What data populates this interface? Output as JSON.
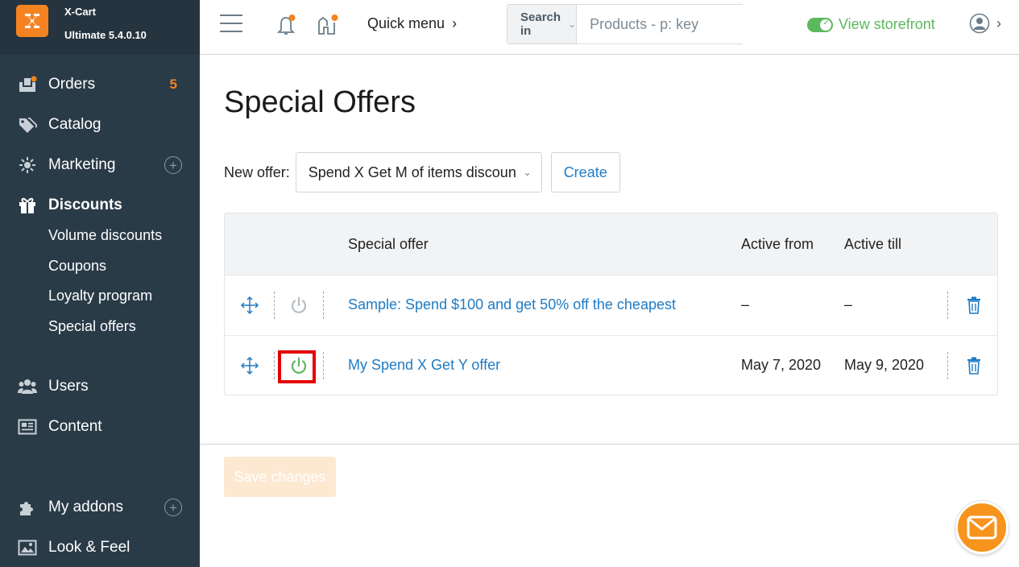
{
  "brand": {
    "name": "X-Cart",
    "version": "Ultimate 5.4.0.10",
    "accent": "#f58220"
  },
  "sidebar": {
    "items": [
      {
        "label": "Orders",
        "icon": "orders-icon",
        "badge": "5"
      },
      {
        "label": "Catalog",
        "icon": "tag-icon"
      },
      {
        "label": "Marketing",
        "icon": "marketing-icon",
        "plus": "+"
      },
      {
        "label": "Discounts",
        "icon": "gift-icon",
        "active": true
      },
      {
        "label": "Users",
        "icon": "users-icon"
      },
      {
        "label": "Content",
        "icon": "content-icon"
      },
      {
        "label": "My addons",
        "icon": "puzzle-icon",
        "plus": "+"
      },
      {
        "label": "Look & Feel",
        "icon": "image-icon"
      }
    ],
    "discounts_sub": [
      "Volume discounts",
      "Coupons",
      "Loyalty program",
      "Special offers"
    ]
  },
  "topbar": {
    "quick_menu": "Quick menu",
    "quick_menu_chevron": "›",
    "search_in": "Search in",
    "search_placeholder": "Products - p: key",
    "view_storefront": "View storefront",
    "user_chevron": "›"
  },
  "page": {
    "title": "Special Offers",
    "new_offer_label": "New offer:",
    "offer_type_selected": "Spend X Get M of items discoun",
    "create_label": "Create",
    "save_label": "Save changes"
  },
  "table": {
    "columns": [
      "Special offer",
      "Active from",
      "Active till"
    ],
    "rows": [
      {
        "name": "Sample: Spend $100 and get 50% off the cheapest",
        "active_from": "–",
        "active_till": "–",
        "enabled": false
      },
      {
        "name": "My Spend X Get Y offer",
        "active_from": "May 7, 2020",
        "active_till": "May 9, 2020",
        "enabled": true
      }
    ]
  },
  "colors": {
    "sidebar_bg": "#2a3b48",
    "link": "#1f7bc4",
    "enabled": "#5cb85c",
    "disabled": "#b5bcc2",
    "highlight": "#e30000",
    "chat": "#f7941d"
  }
}
